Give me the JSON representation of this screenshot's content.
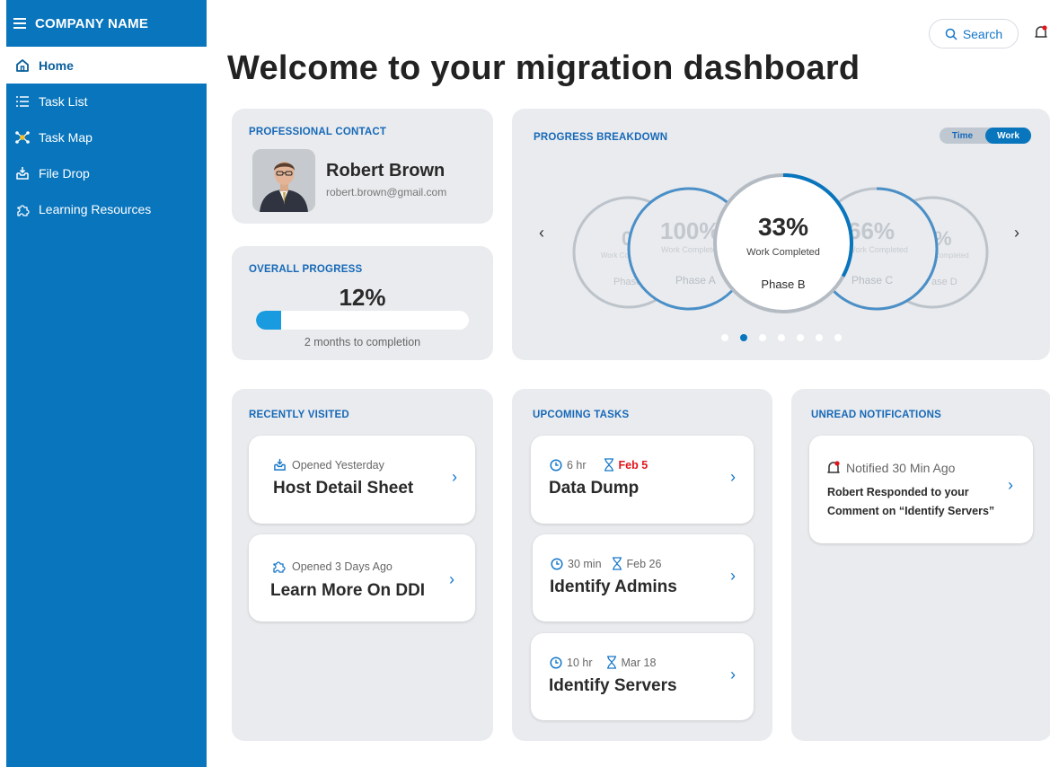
{
  "app": {
    "brand": "COMPANY NAME"
  },
  "sidebar": {
    "items": [
      {
        "label": "Home",
        "icon": "home-icon",
        "active": true
      },
      {
        "label": "Task List",
        "icon": "list-icon",
        "active": false
      },
      {
        "label": "Task Map",
        "icon": "network-icon",
        "active": false
      },
      {
        "label": "File Drop",
        "icon": "inbox-download-icon",
        "active": false
      },
      {
        "label": "Learning Resources",
        "icon": "puzzle-icon",
        "active": false
      }
    ]
  },
  "header": {
    "search_label": "Search",
    "title": "Welcome to your migration dashboard"
  },
  "contact": {
    "heading": "PROFESSIONAL CONTACT",
    "name": "Robert Brown",
    "email": "robert.brown@gmail.com"
  },
  "overall": {
    "heading": "OVERALL PROGRESS",
    "percent_label": "12%",
    "progress": 0.12,
    "caption": "2 months to completion"
  },
  "breakdown": {
    "heading": "PROGRESS BREAKDOWN",
    "toggle": {
      "time": "Time",
      "work": "Work",
      "selected": "Work"
    },
    "center": {
      "percent": "33%",
      "sub": "Work Completed",
      "phase": "Phase B",
      "progress": 0.33
    },
    "left1": {
      "percent": "100%",
      "sub": "Work Completed",
      "phase": "Phase A"
    },
    "left2": {
      "percent": "0",
      "sub": "Work Completed",
      "phase": "Phase"
    },
    "right1": {
      "percent": "66%",
      "sub": "Work Completed",
      "phase": "Phase C"
    },
    "right2": {
      "percent": "%",
      "sub": "Completed",
      "phase": "ase D"
    },
    "prev": "‹",
    "next": "›",
    "dots_count": 7,
    "active_dot": 1
  },
  "recent": {
    "heading": "RECENTLY VISITED",
    "items": [
      {
        "meta": "Opened Yesterday",
        "title": "Host Detail Sheet"
      },
      {
        "meta": "Opened 3 Days Ago",
        "title": "Learn More On DDI"
      }
    ]
  },
  "tasks": {
    "heading": "UPCOMING TASKS",
    "items": [
      {
        "duration": "6 hr",
        "due": "Feb 5",
        "title": "Data Dump",
        "overdue": true
      },
      {
        "duration": "30 min",
        "due": "Feb 26",
        "title": "Identify Admins",
        "overdue": false
      },
      {
        "duration": "10 hr",
        "due": "Mar 18",
        "title": "Identify Servers",
        "overdue": false
      }
    ]
  },
  "notifications": {
    "heading": "UNREAD NOTIFICATIONS",
    "items": [
      {
        "meta": "Notified 30 Min Ago",
        "text": "Robert Responded to your Comment on “Identify Servers”"
      }
    ]
  },
  "colors": {
    "primary": "#0875bd",
    "accent": "#1a9be0",
    "card": "#e9ebee",
    "alert": "#e0161b"
  },
  "chevron": "›"
}
